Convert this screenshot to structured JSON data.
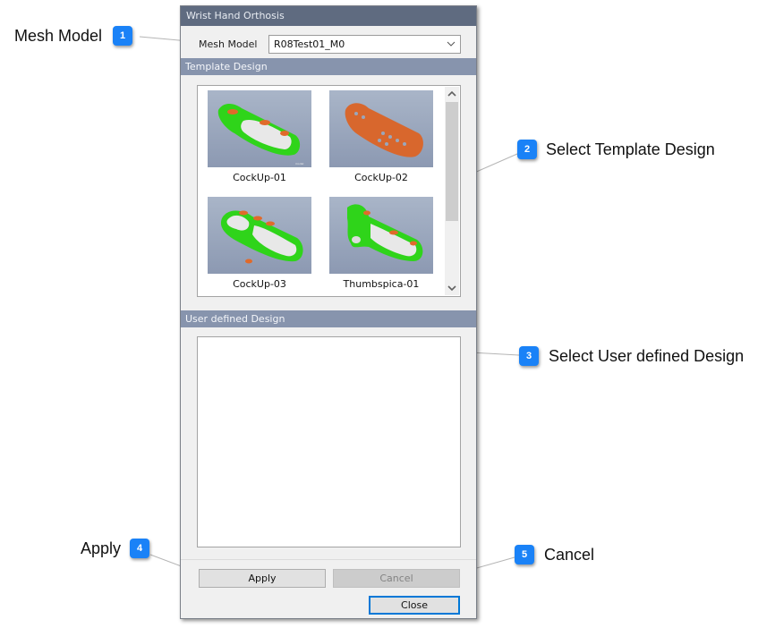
{
  "dialog": {
    "title": "Wrist Hand Orthosis",
    "mesh_model": {
      "label": "Mesh Model",
      "value": "R08Test01_M0",
      "icon": "chevron-down-icon"
    },
    "template_design": {
      "header": "Template Design",
      "items": [
        {
          "label": "CockUp-01",
          "color": "#2fd41a"
        },
        {
          "label": "CockUp-02",
          "color": "#d8672d"
        },
        {
          "label": "CockUp-03",
          "color": "#2fd41a"
        },
        {
          "label": "Thumbspica-01",
          "color": "#2fd41a"
        }
      ]
    },
    "user_defined_design": {
      "header": "User defined Design",
      "items": []
    },
    "buttons": {
      "apply": "Apply",
      "cancel": "Cancel",
      "close": "Close"
    }
  },
  "callouts": [
    {
      "number": "1",
      "text": "Mesh Model"
    },
    {
      "number": "2",
      "text": "Select Template Design"
    },
    {
      "number": "3",
      "text": "Select User defined Design"
    },
    {
      "number": "4",
      "text": "Apply"
    },
    {
      "number": "5",
      "text": "Cancel"
    }
  ],
  "colors": {
    "title_bar": "#5f6b80",
    "section_header": "#8794ad",
    "badge": "#1a82f7",
    "focus_border": "#0078d7"
  }
}
